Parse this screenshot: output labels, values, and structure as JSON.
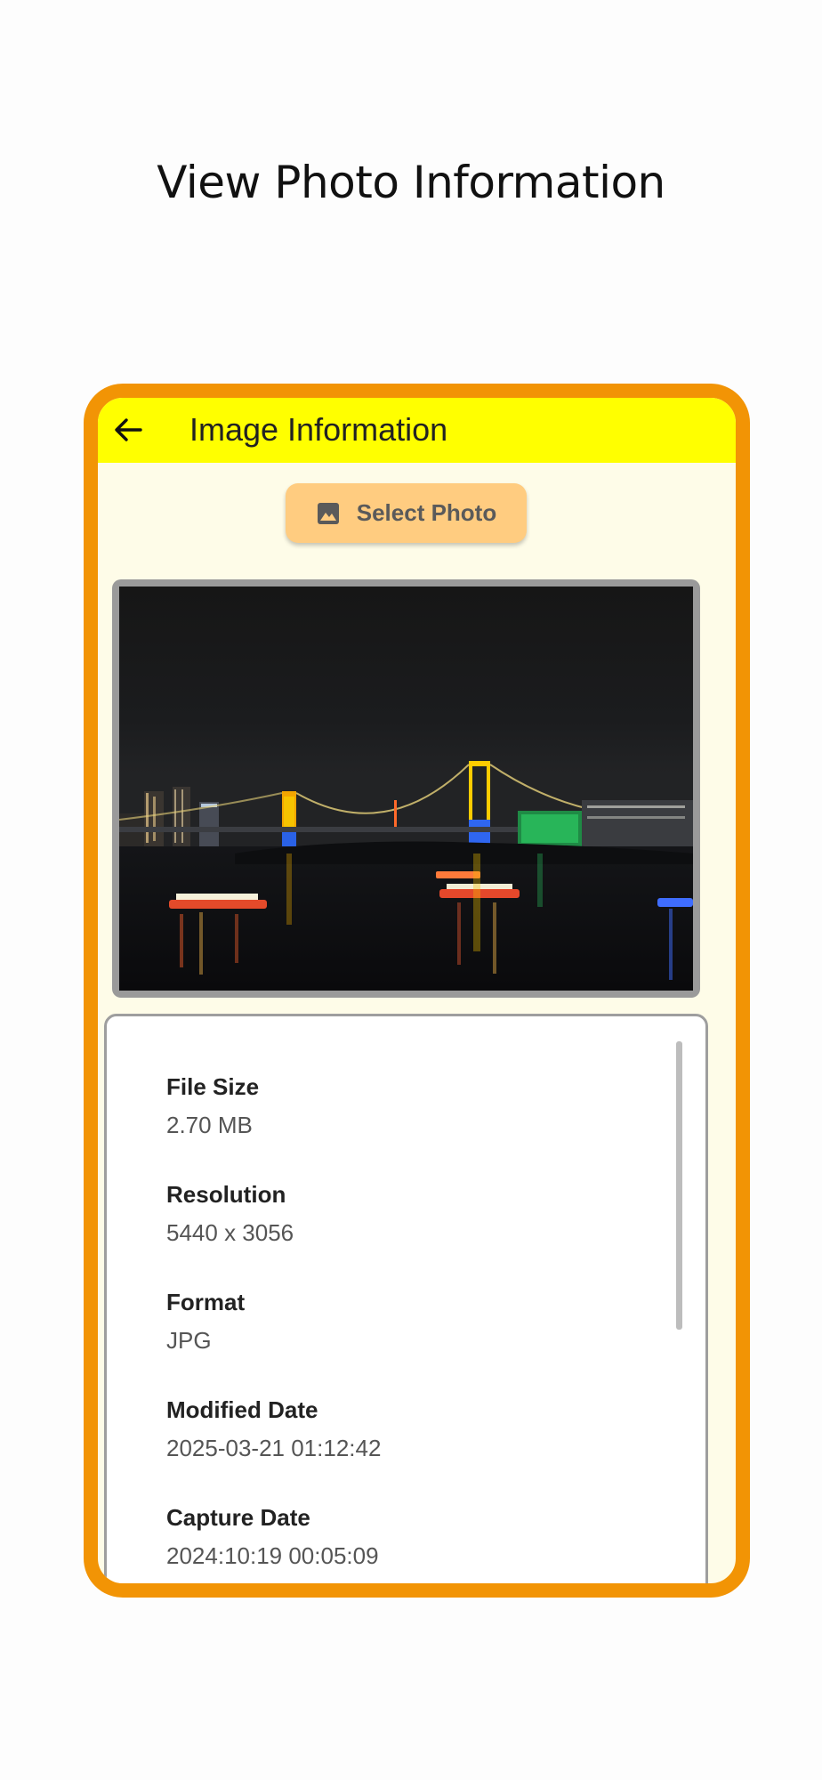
{
  "page": {
    "heading": "View Photo Information"
  },
  "app": {
    "title": "Image Information",
    "back_icon": "arrow-left-icon",
    "select_button": {
      "label": "Select Photo",
      "icon": "image-icon"
    }
  },
  "colors": {
    "frame": "#F29405",
    "appbar": "#FFFF00",
    "background": "#FEFCE8",
    "button": "#FFCC80"
  },
  "info": {
    "items": [
      {
        "label": "File Size",
        "value": "2.70 MB"
      },
      {
        "label": "Resolution",
        "value": "5440 x 3056"
      },
      {
        "label": "Format",
        "value": "JPG"
      },
      {
        "label": "Modified Date",
        "value": "2025-03-21 01:12:42"
      },
      {
        "label": "Capture Date",
        "value": "2024:10:19 00:05:09"
      }
    ]
  }
}
